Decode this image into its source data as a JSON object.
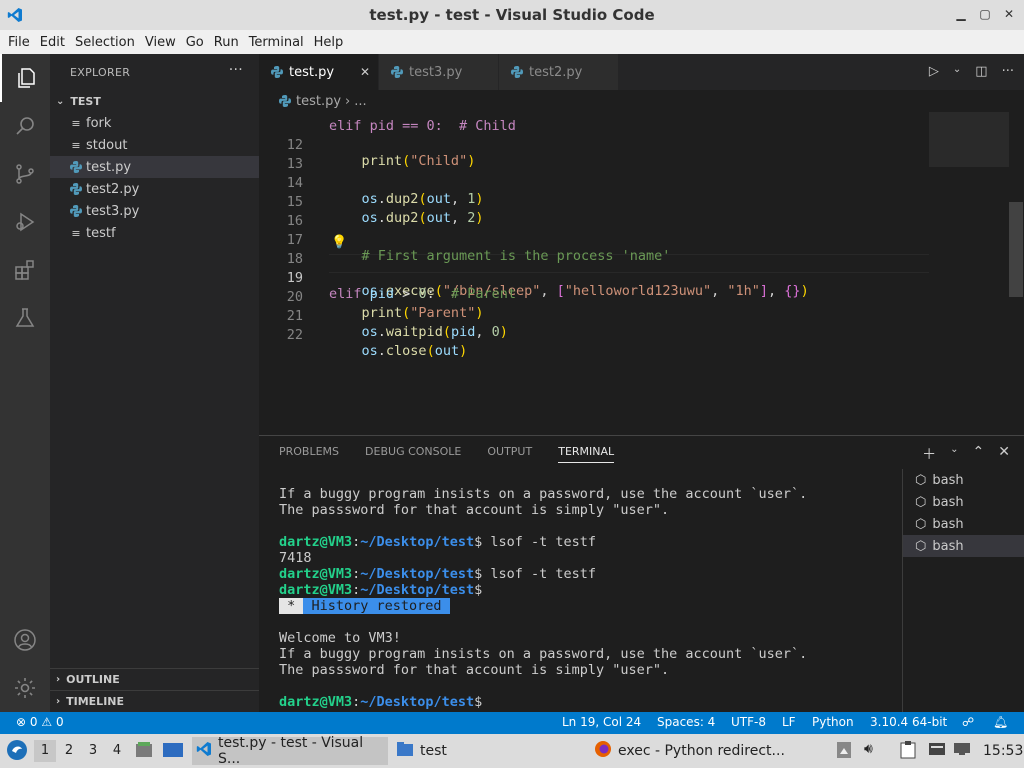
{
  "titlebar": {
    "title": "test.py - test - Visual Studio Code"
  },
  "menu": [
    "File",
    "Edit",
    "Selection",
    "View",
    "Go",
    "Run",
    "Terminal",
    "Help"
  ],
  "sidebar": {
    "header": "EXPLORER",
    "folder": "TEST",
    "files": [
      {
        "name": "fork",
        "type": "plain"
      },
      {
        "name": "stdout",
        "type": "plain"
      },
      {
        "name": "test.py",
        "type": "python",
        "selected": true
      },
      {
        "name": "test2.py",
        "type": "python"
      },
      {
        "name": "test3.py",
        "type": "python"
      },
      {
        "name": "testf",
        "type": "plain"
      }
    ],
    "outline": "OUTLINE",
    "timeline": "TIMELINE"
  },
  "tabs": [
    {
      "label": "test.py",
      "active": true
    },
    {
      "label": "test3.py"
    },
    {
      "label": "test2.py"
    }
  ],
  "breadcrumb": {
    "file": "test.py",
    "rest": "..."
  },
  "editor": {
    "current_line": 19,
    "line_numbers": [
      "12",
      "13",
      "14",
      "15",
      "16",
      "17",
      "18",
      "19",
      "20",
      "21",
      "22"
    ],
    "partial_top_line": "elif pid == 0:  # Child"
  },
  "panel": {
    "tabs": [
      "PROBLEMS",
      "DEBUG CONSOLE",
      "OUTPUT",
      "TERMINAL"
    ],
    "active_tab": "TERMINAL",
    "terminal": {
      "line1": "If a buggy program insists on a password, use the account `user`.",
      "line2": "The passsword for that account is simply \"user\".",
      "prompt_user": "dartz@VM3",
      "prompt_path": "~/Desktop/test",
      "cmd1": " lsof -t testf",
      "out1": "7418",
      "cmd2": " lsof -t testf",
      "history_star": " * ",
      "history_text": " History restored ",
      "welcome": "Welcome to VM3!"
    },
    "terminals": [
      "bash",
      "bash",
      "bash",
      "bash"
    ]
  },
  "status": {
    "errors": "0",
    "warnings": "0",
    "position": "Ln 19, Col 24",
    "spaces": "Spaces: 4",
    "encoding": "UTF-8",
    "eol": "LF",
    "language": "Python",
    "interpreter": "3.10.4 64-bit"
  },
  "taskbar": {
    "desktops": [
      "1",
      "2",
      "3",
      "4"
    ],
    "vscode_task": "test.py - test - Visual S...",
    "folder_task": "test",
    "firefox_task": "exec - Python redirect...",
    "clock": "15:53"
  }
}
